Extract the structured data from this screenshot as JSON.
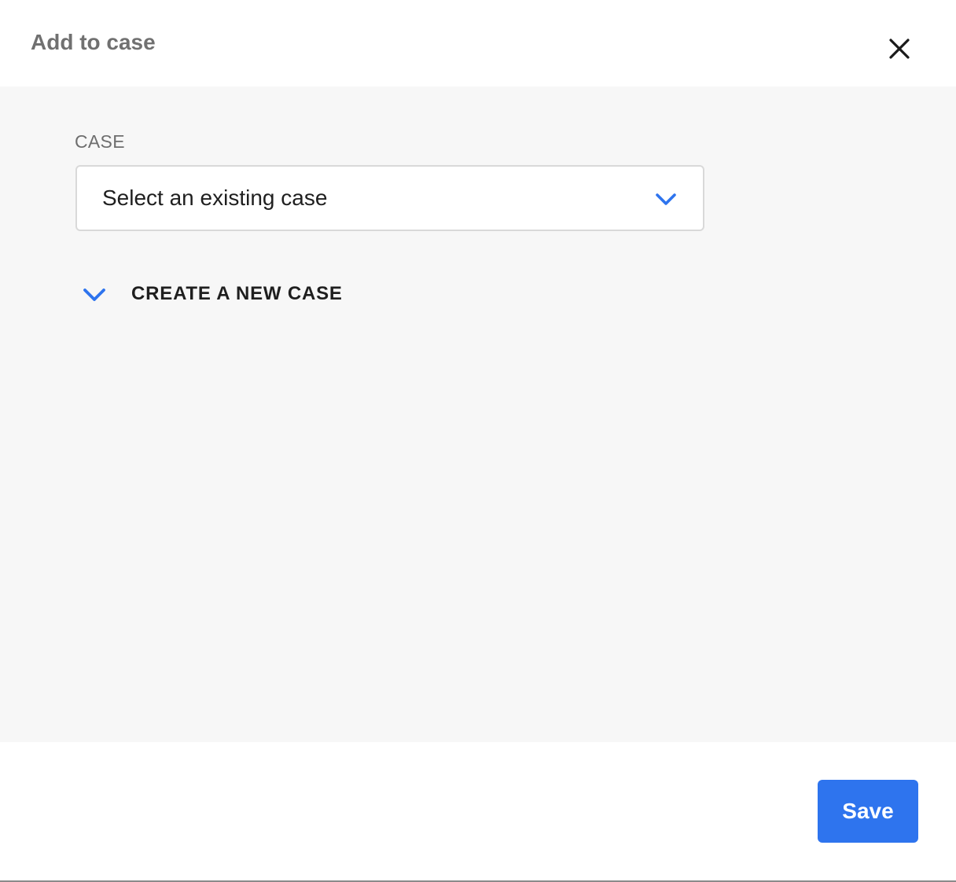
{
  "dialog": {
    "title": "Add to case",
    "close_icon": "close-icon"
  },
  "form": {
    "case_label": "CASE",
    "case_select": {
      "selected_value": "Select an existing case",
      "icon": "chevron-down-icon"
    },
    "create_new": {
      "label": "CREATE A NEW CASE",
      "icon": "chevron-down-icon"
    }
  },
  "footer": {
    "save_label": "Save"
  },
  "colors": {
    "accent": "#2e74ee",
    "body_background": "#f7f7f7",
    "title_text": "#707070",
    "primary_text": "#1f1f1f"
  }
}
